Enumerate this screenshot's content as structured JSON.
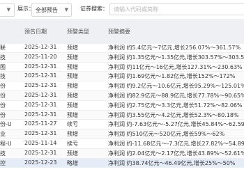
{
  "toolbar": {
    "display_label": "展示：",
    "display_value": "全部预告",
    "search_label": "证券搜索：",
    "search_placeholder": "请输入代码或简称"
  },
  "table": {
    "headers": {
      "name": "",
      "date": "预告日期",
      "type": "预警类型",
      "summary": "预警摘要"
    },
    "rows": [
      {
        "name": "联",
        "date": "2025-12-31",
        "type": "预增",
        "summary": "净利润 约5.4亿元～7亿元,增长256.07%～361.57%"
      },
      {
        "name": "技",
        "date": "2025-11-20",
        "type": "预增",
        "summary": "净利润 约1.35亿元～1.35亿元,增长303.57%～303.5"
      },
      {
        "name": "图",
        "date": "2025-12-31",
        "type": "预增",
        "summary": "净利润 约11亿元～16亿元,增长127.31%～230.63%"
      },
      {
        "name": "技",
        "date": "2025-12-31",
        "type": "预增",
        "summary": "净利润 约1.69亿元～1.82亿元,增长152%～172%"
      },
      {
        "name": "份",
        "date": "2025-12-31",
        "type": "预增",
        "summary": "净利润 约9.2亿元～10.6亿元,增长95.29%～125.01%"
      },
      {
        "name": "份",
        "date": "2025-12-31",
        "type": "预增",
        "summary": "净利润 约82.9亿元～88.9亿元,增长77.78%～90.65%"
      },
      {
        "name": "份",
        "date": "2025-12-31",
        "type": "预增",
        "summary": "净利润 约2.75亿元～3.3亿元,增长51.72%～82.06%"
      },
      {
        "name": "份",
        "date": "2025-12-31",
        "type": "预增",
        "summary": "净利润 约3.55亿元～4.2亿元,增长52.3%～80.18%"
      },
      {
        "name": "份-U",
        "date": "2025-11-27",
        "type": "续亏",
        "summary": "净利润 约-7.63亿元～-5.27亿元,增长45.84%～62.59"
      },
      {
        "name": "业",
        "date": "2025-12-31",
        "type": "预增",
        "summary": "净利润 约510亿元～520亿元,增长59%～62%"
      },
      {
        "name": "程-U",
        "date": "2025-11-14",
        "type": "续亏",
        "summary": "净利润 约-11.68亿元～-7.3亿元,增长27.82%～54.89"
      },
      {
        "name": "技",
        "date": "2025-12-31",
        "type": "预增",
        "summary": "净利润 约2.04亿元～2.17亿元,增长43.89%～52.61%"
      },
      {
        "name": "控",
        "date": "2025-12-23",
        "type": "略增",
        "summary": "净利润 约38.74亿元～46.49亿元,增长25%～50%"
      }
    ]
  }
}
